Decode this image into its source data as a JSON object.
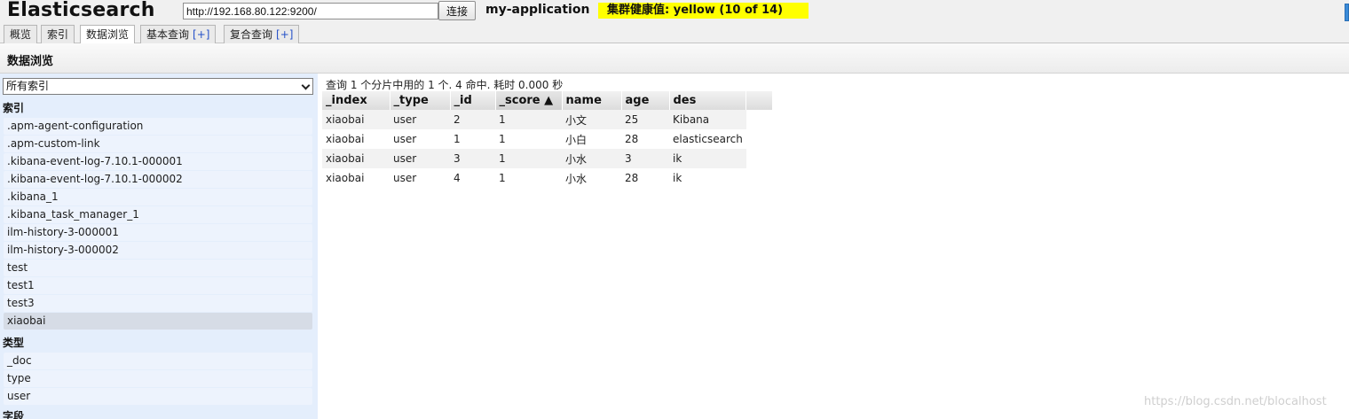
{
  "header": {
    "app_title": "Elasticsearch",
    "url_value": "http://192.168.80.122:9200/",
    "connect_label": "连接",
    "cluster_name": "my-application",
    "health_text": "集群健康值: yellow (10 of 14)",
    "health_color": "#ffff00"
  },
  "tabs": [
    {
      "label": "概览",
      "plus": ""
    },
    {
      "label": "索引",
      "plus": ""
    },
    {
      "label": "数据浏览",
      "plus": ""
    },
    {
      "label": "基本查询",
      "plus": "[+]"
    },
    {
      "label": "复合查询",
      "plus": "[+]"
    }
  ],
  "page": {
    "title": "数据浏览"
  },
  "sidebar": {
    "select_value": "所有索引",
    "indices_heading": "索引",
    "indices": [
      ".apm-agent-configuration",
      ".apm-custom-link",
      ".kibana-event-log-7.10.1-000001",
      ".kibana-event-log-7.10.1-000002",
      ".kibana_1",
      ".kibana_task_manager_1",
      "ilm-history-3-000001",
      "ilm-history-3-000002",
      "test",
      "test1",
      "test3",
      "xiaobai"
    ],
    "selected_index": "xiaobai",
    "types_heading": "类型",
    "types": [
      "_doc",
      "type",
      "user"
    ],
    "fields_heading": "字段"
  },
  "results": {
    "summary": "查询 1 个分片中用的 1 个. 4 命中. 耗时 0.000 秒",
    "columns": [
      "_index",
      "_type",
      "_id",
      "_score ▲",
      "name",
      "age",
      "des"
    ],
    "rows": [
      [
        "xiaobai",
        "user",
        "2",
        "1",
        "小文",
        "25",
        "Kibana"
      ],
      [
        "xiaobai",
        "user",
        "1",
        "1",
        "小白",
        "28",
        "elasticsearch"
      ],
      [
        "xiaobai",
        "user",
        "3",
        "1",
        "小水",
        "3",
        "ik"
      ],
      [
        "xiaobai",
        "user",
        "4",
        "1",
        "小水",
        "28",
        "ik"
      ]
    ]
  },
  "watermark": "https://blog.csdn.net/blocalhost"
}
